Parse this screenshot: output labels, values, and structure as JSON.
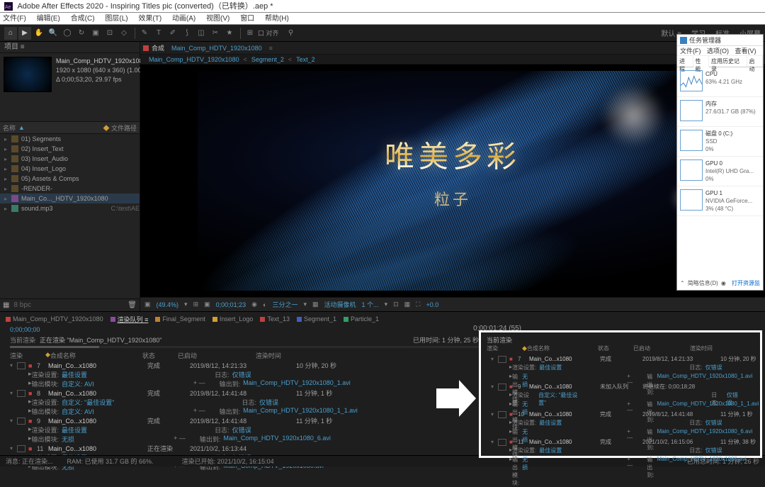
{
  "window": {
    "title": "Adobe After Effects 2020 - Inspiring Titles pic (converted)（已转换）.aep *"
  },
  "menu": {
    "file": "文件(F)",
    "edit": "编辑(E)",
    "comp": "合成(C)",
    "layer": "图层(L)",
    "effect": "效果(T)",
    "anim": "动画(A)",
    "view": "视图(V)",
    "window": "窗口",
    "help": "帮助(H)"
  },
  "top_links": {
    "default": "默认 ≡",
    "learn": "学习",
    "std": "标准",
    "small": "小屏幕"
  },
  "project": {
    "panel": "项目 ≡",
    "name": "Main_Comp_HDTV_1920x1080▼",
    "dims": "1920 x 1080 (640 x 360) (1.00)",
    "dur": "Δ 0;00;53;20, 29.97 fps",
    "col_name": "名称",
    "col_tag": "文件路径",
    "items": [
      {
        "ico": "folder",
        "label": "01) Segments"
      },
      {
        "ico": "folder",
        "label": "02) Insert_Text"
      },
      {
        "ico": "folder",
        "label": "03) Insert_Audio"
      },
      {
        "ico": "folder",
        "label": "04) Insert_Logo"
      },
      {
        "ico": "folder",
        "label": "05) Assets & Comps"
      },
      {
        "ico": "folder",
        "label": "-RENDER-"
      },
      {
        "ico": "comp",
        "label": "Main_Co..._HDTV_1920x1080",
        "sel": true
      },
      {
        "ico": "audio",
        "label": "sound.mp3",
        "tag": "C:\\test\\AE"
      }
    ]
  },
  "viewer": {
    "tab_label": "合成",
    "tab_name": "Main_Comp_HDTV_1920x1080",
    "crumb": [
      "Main_Comp_HDTV_1920x1080",
      "Segment_2",
      "Text_2"
    ],
    "title_text": "唯美多彩",
    "subtitle_text": "粒子",
    "zoom": "(49.4%)",
    "time": "0;00;01;23",
    "mode": "三分之一",
    "cam": "活动摄像机",
    "views": "1 个...",
    "exp": "+0.0"
  },
  "timeline_tabs": [
    {
      "c": "#c04040",
      "t": "Main_Comp_HDTV_1920x1080"
    },
    {
      "c": "#8a4aa0",
      "t": "渲染队列 ≡",
      "act": true
    },
    {
      "c": "#c08030",
      "t": "Final_Segment"
    },
    {
      "c": "#d0a030",
      "t": "Insert_Logo"
    },
    {
      "c": "#c04040",
      "t": "Text_13"
    },
    {
      "c": "#4060c0",
      "t": "Segment_1"
    },
    {
      "c": "#30a060",
      "t": "Particle_1"
    }
  ],
  "render": {
    "time_hdr": "0;00;00;00",
    "r_hdr": "0;00;01;24 (55)",
    "current": "当前渲染",
    "status": "正在渲染 \"Main_Comp_HDTV_1920x1080\"",
    "elapsed_lbl": "已用时间:",
    "elapsed": "1 分钟, 25 秒",
    "cols": {
      "render": "渲染",
      "name": "合成名称",
      "state": "状态",
      "start": "已启动",
      "dur": "渲染时间"
    },
    "rows": [
      {
        "n": "7",
        "name": "Main_Co...x1080",
        "state": "完成",
        "start": "2019/8/12, 14:21:33",
        "dur": "10 分钟, 20 秒",
        "rs": "最佳设置",
        "log": "仅错误",
        "om": "自定义: AVI",
        "out": "Main_Comp_HDTV_1920x1080_1.avi"
      },
      {
        "n": "8",
        "name": "Main_Co...x1080",
        "state": "完成",
        "start": "2019/8/12, 14:41:48",
        "dur": "11 分钟, 1 秒",
        "rs": "自定义: \"最佳设置\"",
        "log": "仅错误",
        "om": "自定义: AVI",
        "out": "Main_Comp_HDTV_1920x1080_1_1.avi"
      },
      {
        "n": "9",
        "name": "Main_Co...x1080",
        "state": "完成",
        "start": "2019/8/12, 14:41:48",
        "dur": "11 分钟, 1 秒",
        "rs": "最佳设置",
        "log": "仅错误",
        "om": "无损",
        "out": "Main_Comp_HDTV_1920x1080_6.avi"
      },
      {
        "n": "11",
        "name": "Main_Co...x1080",
        "state": "正在渲染",
        "start": "2021/10/2, 16:13:44",
        "dur": "",
        "rs": "最佳设置",
        "log": "仅错误",
        "om": "无损",
        "out": "Main_Comp_HDTV_1920x1080.avi"
      }
    ],
    "labels": {
      "rs": "渲染设置:",
      "log": "日志:",
      "om": "输出模块:",
      "out": "输出到:"
    }
  },
  "footer": {
    "msg": "消息: 正在渲染...",
    "ram": "RAM: 已使用 31.7 GB 的 66%.",
    "start": "渲染已开始: 2021/10/2, 16:15:04",
    "total": "已用总时间: 1 分钟, 26 秒"
  },
  "callout": {
    "title": "当前渲染",
    "rows": [
      {
        "n": "7",
        "name": "Main_Co...x1080",
        "state": "完成",
        "start": "2019/8/12, 14:21:33",
        "dur": "10 分钟, 20 秒",
        "out": "Main_Comp_HDTV_1920x1080_1.avi"
      },
      {
        "n": "9",
        "name": "Main_Co...x1080",
        "state": "未加入队列",
        "start": "将继续在: 0;00;18;28",
        "dur": "",
        "out": "Main_Comp_HDTV_1920x1080_1_1.avi",
        "rs": "自定义: \"最佳设置\""
      },
      {
        "n": "10",
        "name": "Main_Co...x1080",
        "state": "完成",
        "start": "2019/8/12, 14:41:48",
        "dur": "11 分钟, 1 秒",
        "out": "Main_Comp_HDTV_1920x1080_6.avi"
      },
      {
        "n": "11",
        "name": "Main_Co...x1080",
        "state": "完成",
        "start": "2021/10/2, 16:15:06",
        "dur": "11 分钟, 38 秒",
        "out": "Main_Comp_HDTV_1920x1080.avi"
      }
    ]
  },
  "taskmgr": {
    "title": "任务管理器",
    "menu": {
      "file": "文件(F)",
      "opt": "选项(O)",
      "view": "查看(V)"
    },
    "tabs": [
      "进程",
      "性能",
      "应用历史记录",
      "启动"
    ],
    "cards": [
      {
        "name": "CPU",
        "val": "63% 4.21 GHz",
        "spark": true
      },
      {
        "name": "内存",
        "val": "27.6/31.7 GB (87%)"
      },
      {
        "name": "磁盘 0 (C:)",
        "val": "SSD",
        "val2": "0%"
      },
      {
        "name": "GPU 0",
        "val": "Intel(R) UHD Gra...",
        "val2": "0%"
      },
      {
        "name": "GPU 1",
        "val": "NVIDIA GeForce...",
        "val2": "3% (48 °C)"
      }
    ],
    "brief": "简略信息(D)",
    "open": "打开资源监"
  }
}
